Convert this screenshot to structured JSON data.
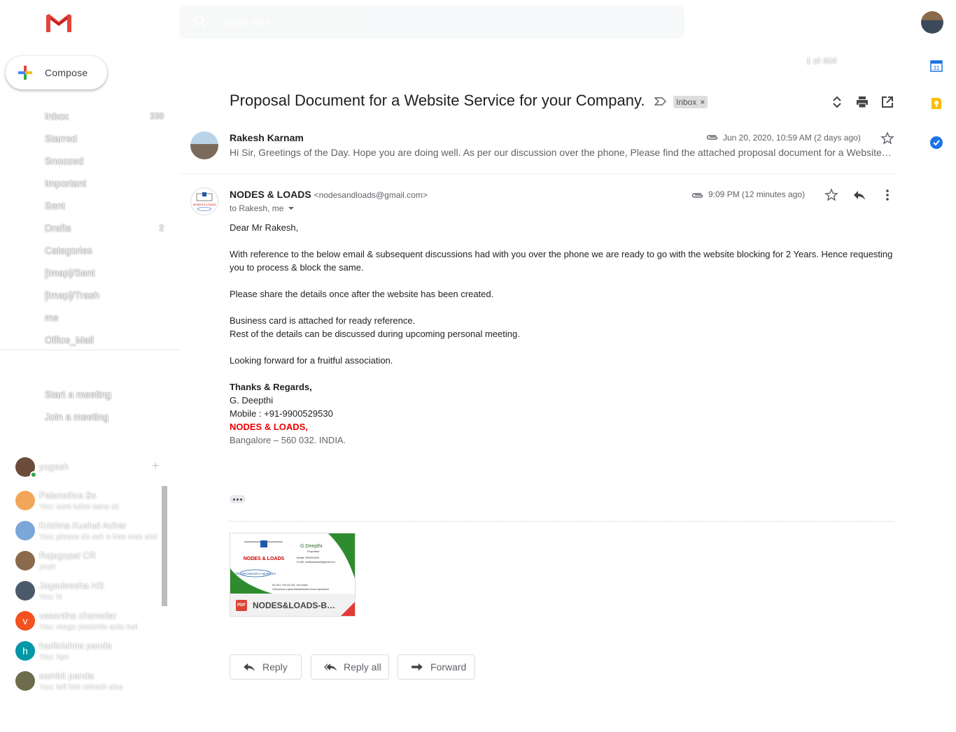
{
  "app": {
    "name": "Gmail"
  },
  "compose_label": "Compose",
  "nav": [
    {
      "label": "Inbox",
      "count": "339"
    },
    {
      "label": "Starred",
      "count": ""
    },
    {
      "label": "Snoozed",
      "count": ""
    },
    {
      "label": "Important",
      "count": ""
    },
    {
      "label": "Sent",
      "count": ""
    },
    {
      "label": "Drafts",
      "count": "2"
    },
    {
      "label": "Categories",
      "count": ""
    },
    {
      "label": "[Imap]/Sent",
      "count": ""
    },
    {
      "label": "[Imap]/Trash",
      "count": ""
    },
    {
      "label": "me",
      "count": ""
    },
    {
      "label": "Office_Mail",
      "count": ""
    }
  ],
  "meet": {
    "start": "Start a meeting",
    "join": "Join a meeting"
  },
  "hangouts": {
    "user": "yogesh",
    "contacts": [
      {
        "name": "Palanethra Bs",
        "msg": "You: sent tuthe sana sit",
        "color": "#f2a65a"
      },
      {
        "name": "Krishna Kushal Achar",
        "msg": "You: please do ask a free mos and",
        "color": "#7aa6d8"
      },
      {
        "name": "Rajagopal CR",
        "msg": "yeah",
        "color": "#8a6a4a"
      },
      {
        "name": "Jagadeesha HS",
        "msg": "You: hi",
        "color": "#4a5a6a"
      },
      {
        "name": "vasantha chanadar",
        "msg": "You: mega yesterde acta hell",
        "color": "#f4511e",
        "initial": "v"
      },
      {
        "name": "harikrishna panda",
        "msg": "You: hpn",
        "color": "#0097a7",
        "initial": "h"
      },
      {
        "name": "sambit panda",
        "msg": "You: tell him refresh also",
        "color": "#6d6d4d"
      }
    ]
  },
  "search": {
    "placeholder": "Search mail"
  },
  "pager": "1 of 404",
  "thread": {
    "subject": "Proposal Document for a Website Service for your Company.",
    "label": "Inbox"
  },
  "message1": {
    "sender": "Rakesh Karnam",
    "date": "Jun 20, 2020, 10:59 AM (2 days ago)",
    "snippet": "Hi Sir, Greetings of the Day. Hope you are doing well. As per our discussion over the phone, Please find the attached proposal document for a Website for your Company."
  },
  "message2": {
    "sender": "NODES & LOADS",
    "email": "<nodesandloads@gmail.com>",
    "to": "to Rakesh, me",
    "date": "9:09 PM (12 minutes ago)",
    "body": {
      "greeting": "Dear Mr Rakesh,",
      "p1": "With reference to the below email & subsequent discussions had with you over the phone we are ready to go with the website blocking for 2 Years. Hence requesting you to process & block the same.",
      "p2": "Please share the details once after the website has been created.",
      "p3a": "Business card is attached for ready reference.",
      "p3b": "Rest of the details can be discussed during upcoming personal meeting.",
      "p4": "Looking forward for a fruitful association.",
      "sig1": "Thanks & Regards,",
      "sig2": "G. Deepthi",
      "sig3": "Mobile : +91-9900529530",
      "sig4": "NODES & LOADS,",
      "sig5": "Bangalore – 560 032. INDIA."
    },
    "attachment": {
      "name": "NODES&LOADS-Bu...",
      "type": "PDF",
      "card_name": "G.Deepthi",
      "card_title": "Proprietor",
      "card_mobile": "Mobile: 9900529530",
      "card_email": "E-mail: nodesandloads@gmail.com",
      "card_logo": "NODES & LOADS",
      "card_tag": "The Mechatronics Appetizers",
      "card_addr1": "No.19/1, Plot No.292, 1st A Main,",
      "card_addr2": "Chinnamma Layout,Banashankari Aurum Apartment"
    }
  },
  "actions": {
    "reply": "Reply",
    "reply_all": "Reply all",
    "forward": "Forward"
  },
  "colors": {
    "red_sig": "#ee0000",
    "accent": "#1a73e8"
  }
}
